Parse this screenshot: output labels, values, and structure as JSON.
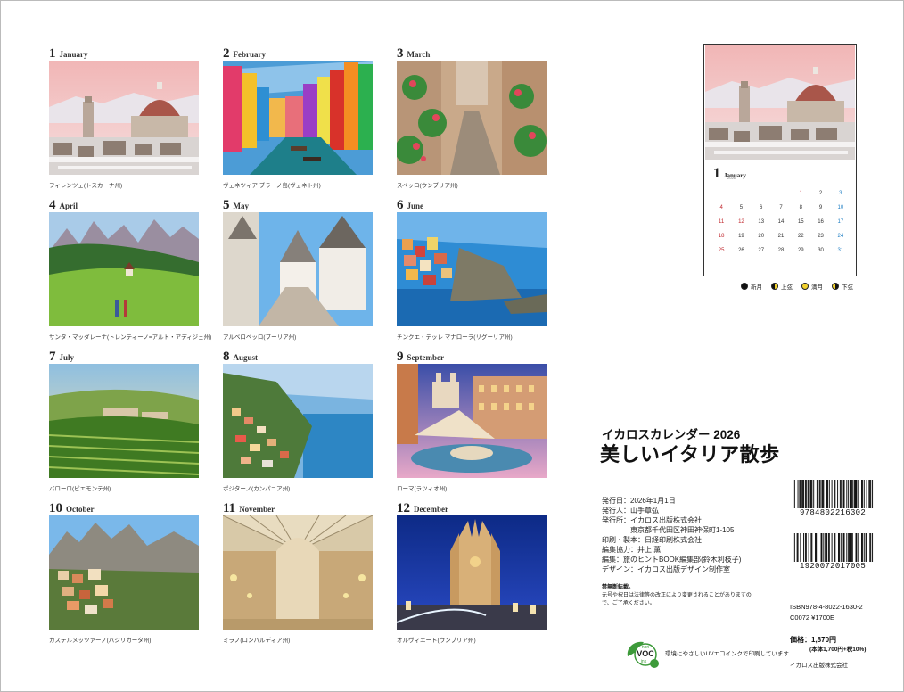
{
  "months": [
    {
      "num": "1",
      "name": "January",
      "caption": "フィレンツェ(トスカーナ州)",
      "scene": "florence"
    },
    {
      "num": "2",
      "name": "February",
      "caption": "ヴェネツィア ブラーノ島(ヴェネト州)",
      "scene": "burano"
    },
    {
      "num": "3",
      "name": "March",
      "caption": "スペッロ(ウンブリア州)",
      "scene": "spello"
    },
    {
      "num": "4",
      "name": "April",
      "caption": "サンタ・マッダレーナ(トレンティーノ=アルト・アディジェ州)",
      "scene": "dolomites"
    },
    {
      "num": "5",
      "name": "May",
      "caption": "アルベロベッロ(プーリア州)",
      "scene": "alberobello"
    },
    {
      "num": "6",
      "name": "June",
      "caption": "チンクエ・テッレ マナローラ(リグーリア州)",
      "scene": "manarola"
    },
    {
      "num": "7",
      "name": "July",
      "caption": "バローロ(ピエモンテ州)",
      "scene": "barolo"
    },
    {
      "num": "8",
      "name": "August",
      "caption": "ポジターノ(カンパニア州)",
      "scene": "positano"
    },
    {
      "num": "9",
      "name": "September",
      "caption": "ローマ(ラツィオ州)",
      "scene": "rome"
    },
    {
      "num": "10",
      "name": "October",
      "caption": "カステルメッツァーノ(バジリカータ州)",
      "scene": "castelmezzano"
    },
    {
      "num": "11",
      "name": "November",
      "caption": "ミラノ(ロンバルディア州)",
      "scene": "milano"
    },
    {
      "num": "12",
      "name": "December",
      "caption": "オルヴィエート(ウンブリア州)",
      "scene": "orvieto"
    }
  ],
  "sample_page": {
    "num": "1",
    "month": "January",
    "year": "2026",
    "days": [
      "",
      "",
      "",
      "",
      "1",
      "2",
      "3",
      "4",
      "5",
      "6",
      "7",
      "8",
      "9",
      "10",
      "11",
      "12",
      "13",
      "14",
      "15",
      "16",
      "17",
      "18",
      "19",
      "20",
      "21",
      "22",
      "23",
      "24",
      "25",
      "26",
      "27",
      "28",
      "29",
      "30",
      "31"
    ]
  },
  "moon_legend": [
    {
      "phase": "new",
      "label": "新月"
    },
    {
      "phase": "first",
      "label": "上弦"
    },
    {
      "phase": "full",
      "label": "満月"
    },
    {
      "phase": "last",
      "label": "下弦"
    }
  ],
  "series_title": "イカロスカレンダー 2026",
  "main_title": "美しいイタリア散歩",
  "colophon": [
    "発行日：2026年1月1日",
    "発行人：山手章弘",
    "発行所：イカロス出版株式会社",
    "　　　　東京都千代田区神田神保町1-105",
    "印刷・製本：日経印刷株式会社",
    "編集協力：井上 薫",
    "編集：旅のヒントBOOK編集部(鈴木利枝子)",
    "デザイン：イカロス出版デザイン制作室"
  ],
  "notice_title": "禁無断転載。",
  "notice_body": "元号や祝日は法律等の改正により変更されることがありますので、ご了承ください。",
  "eco_text_1": "環境にやさしいUVエコインクで印刷しています",
  "barcode_1": "9784802216302",
  "barcode_2": "1920072017005",
  "isbn": "ISBN978-4-8022-1630-2",
  "c_code": "C0072 ¥1700E",
  "price_label": "価格：1,870円",
  "price_detail": "(本体1,700円+税10%)",
  "publisher_small": "イカロス出版株式会社"
}
